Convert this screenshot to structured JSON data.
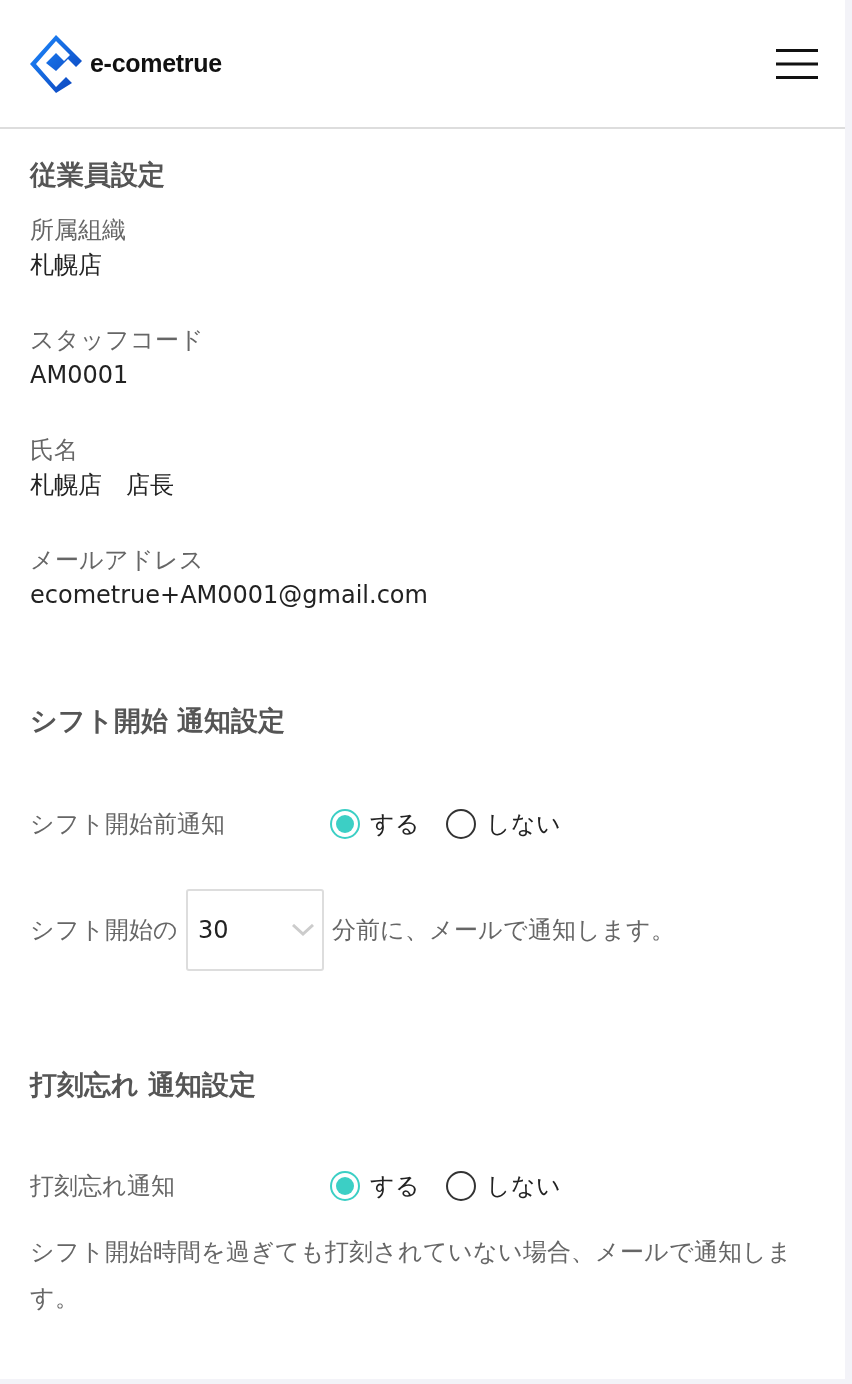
{
  "header": {
    "logo_text": "e-cometrue"
  },
  "employee": {
    "title": "従業員設定",
    "fields": [
      {
        "label": "所属組織",
        "value": "札幌店"
      },
      {
        "label": "スタッフコード",
        "value": "AM0001"
      },
      {
        "label": "氏名",
        "value": "札幌店　店長"
      },
      {
        "label": "メールアドレス",
        "value": "ecometrue+AM0001@gmail.com"
      }
    ]
  },
  "shift_start": {
    "title": "シフト開始 通知設定",
    "label": "シフト開始前通知",
    "options": [
      {
        "label": "する",
        "selected": true
      },
      {
        "label": "しない",
        "selected": false
      }
    ],
    "before_text": "シフト開始の",
    "select_value": "30",
    "after_text": "分前に、メールで通知します。"
  },
  "clock_forget": {
    "title": "打刻忘れ 通知設定",
    "label": "打刻忘れ通知",
    "options": [
      {
        "label": "する",
        "selected": true
      },
      {
        "label": "しない",
        "selected": false
      }
    ],
    "note": "シフト開始時間を過ぎても打刻されていない場合、メールで通知します。"
  }
}
